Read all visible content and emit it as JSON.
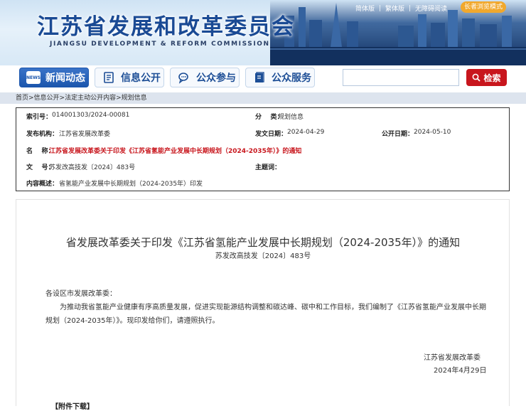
{
  "header": {
    "title": "江苏省发展和改革委员会",
    "subtitle": "JIANGSU DEVELOPMENT & REFORM COMMISSION",
    "top_links": [
      "简体版",
      "繁体版",
      "无障碍阅读"
    ],
    "elder_mode": "长者浏览模式",
    "colors": {
      "title": "#1a4a94",
      "elder_button": "#f1a82d"
    }
  },
  "nav": {
    "items": [
      {
        "label": "新闻动态",
        "icon": "news-icon"
      },
      {
        "label": "信息公开",
        "icon": "document-icon"
      },
      {
        "label": "公众参与",
        "icon": "chat-bubbles-icon"
      },
      {
        "label": "公众服务",
        "icon": "book-icon"
      }
    ],
    "search_value": "",
    "search_button": "检索",
    "news_icon_text": "NEWS",
    "colors": {
      "active": "#1b56ad",
      "search_button": "#c8161d"
    }
  },
  "breadcrumb": {
    "text": "首页>信息公开>法定主动公开内容>规划信息"
  },
  "info": {
    "index_label": "索引号：",
    "index_value": "014001303/2024-00081",
    "category_label": "分    类：",
    "category_value": "规划信息",
    "publisher_label": "发布机构：",
    "publisher_value": "江苏省发展改革委",
    "issue_date_label": "发文日期：",
    "issue_date_value": "2024-04-29",
    "publish_date_label": "公开日期：",
    "publish_date_value": "2024-05-10",
    "name_label": "名    称：",
    "name_value": "江苏省发展改革委关于印发《江苏省氢能产业发展中长期规划（2024-2035年）》的通知",
    "docno_label": "文    号：",
    "docno_value": "苏发改高技发〔2024〕483号",
    "subject_label": "主题词：",
    "subject_value": "",
    "summary_label": "内容概述：",
    "summary_value": "省氢能产业发展中长期规划（2024-2035年）印发"
  },
  "article": {
    "title": "省发展改革委关于印发《江苏省氢能产业发展中长期规划（2024-2035年）》的通知",
    "doc_number": "苏发改高技发〔2024〕483号",
    "salutation": "各设区市发展改革委：",
    "body": "为推动我省氢能产业健康有序高质量发展，促进实现能源结构调整和碳达峰、碳中和工作目标，我们编制了《江苏省氢能产业发展中长期规划（2024-2035年）》。现印发给你们，请遵照执行。",
    "signer": "江苏省发展改革委",
    "sign_date": "2024年4月29日",
    "attachment_label": "【附件下载】"
  }
}
